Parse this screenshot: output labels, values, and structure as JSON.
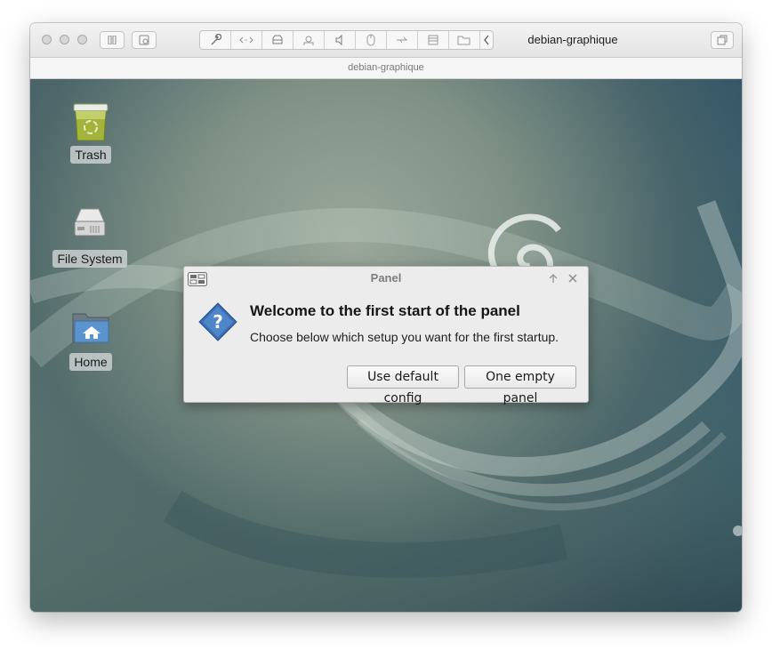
{
  "window": {
    "title": "debian-graphique",
    "subtitle": "debian-graphique"
  },
  "toolbar": {
    "tools": [
      "wrench-icon",
      "code-arrows-icon",
      "drive-icon",
      "camera-icon",
      "speaker-icon",
      "mouse-icon",
      "usb-icon",
      "storage-icon",
      "shared-folder-icon",
      "chevron-left-icon"
    ]
  },
  "desktop": {
    "icons": [
      {
        "label": "Trash",
        "icon": "trash-icon"
      },
      {
        "label": "File System",
        "icon": "hard-drive-icon"
      },
      {
        "label": "Home",
        "icon": "home-folder-icon"
      }
    ]
  },
  "dialog": {
    "title": "Panel",
    "heading": "Welcome to the first start of the panel",
    "message": "Choose below which setup you want for the first startup.",
    "buttons": {
      "default": "Use default config",
      "empty": "One empty panel"
    }
  },
  "colors": {
    "desktop_top": "#2c5168",
    "desktop_mid": "#7f9186",
    "dialog_bg": "#ececec",
    "question_blue": "#3a6fb5"
  }
}
